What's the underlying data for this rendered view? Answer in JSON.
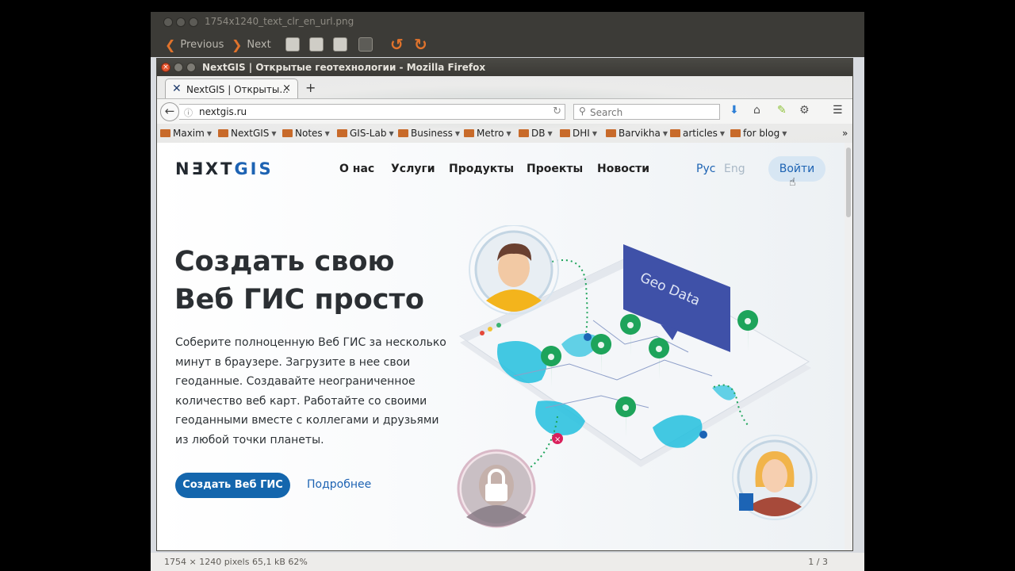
{
  "viewer": {
    "title": "1754x1240_text_clr_en_url.png",
    "previous_label": "Previous",
    "next_label": "Next",
    "status_left": "1754 × 1240 pixels  65,1 kB   62%",
    "status_right": "1 / 3"
  },
  "firefox": {
    "window_title": "NextGIS | Открытые геотехнологии - Mozilla Firefox",
    "tab_title": "NextGIS | Открыты...",
    "tab_close": "×",
    "new_tab": "+",
    "url": "nextgis.ru",
    "search_placeholder": "Search",
    "bookmarks": [
      "Maxim",
      "NextGIS",
      "Notes",
      "GIS-Lab",
      "Business",
      "Metro",
      "DB",
      "DHI",
      "Barvikha",
      "articles",
      "for blog"
    ],
    "overflow": "»"
  },
  "site": {
    "logo_part1": "NƎXT",
    "logo_part2": "GIS",
    "nav": [
      "О нас",
      "Услуги",
      "Продукты",
      "Проекты",
      "Новости"
    ],
    "lang_ru": "Рус",
    "lang_en": "Eng",
    "login": "Войти",
    "hero_title_line1": "Создать свою",
    "hero_title_line2": "Веб ГИС просто",
    "hero_text": "Соберите полноценную Веб ГИС за несколько минут в браузере. Загрузите в нее свои геоданные. Создавайте неограниченное количество веб карт. Работайте со своими геоданными вместе с коллегами и друзьями из любой точки планеты.",
    "cta": "Создать Веб ГИС",
    "more": "Подробнее",
    "banner": "Geo Data"
  },
  "colors": {
    "accent": "#1466ad",
    "viewer_bg": "#3c3b37",
    "pin": "#1ea45b",
    "banner": "#3f51a8"
  }
}
